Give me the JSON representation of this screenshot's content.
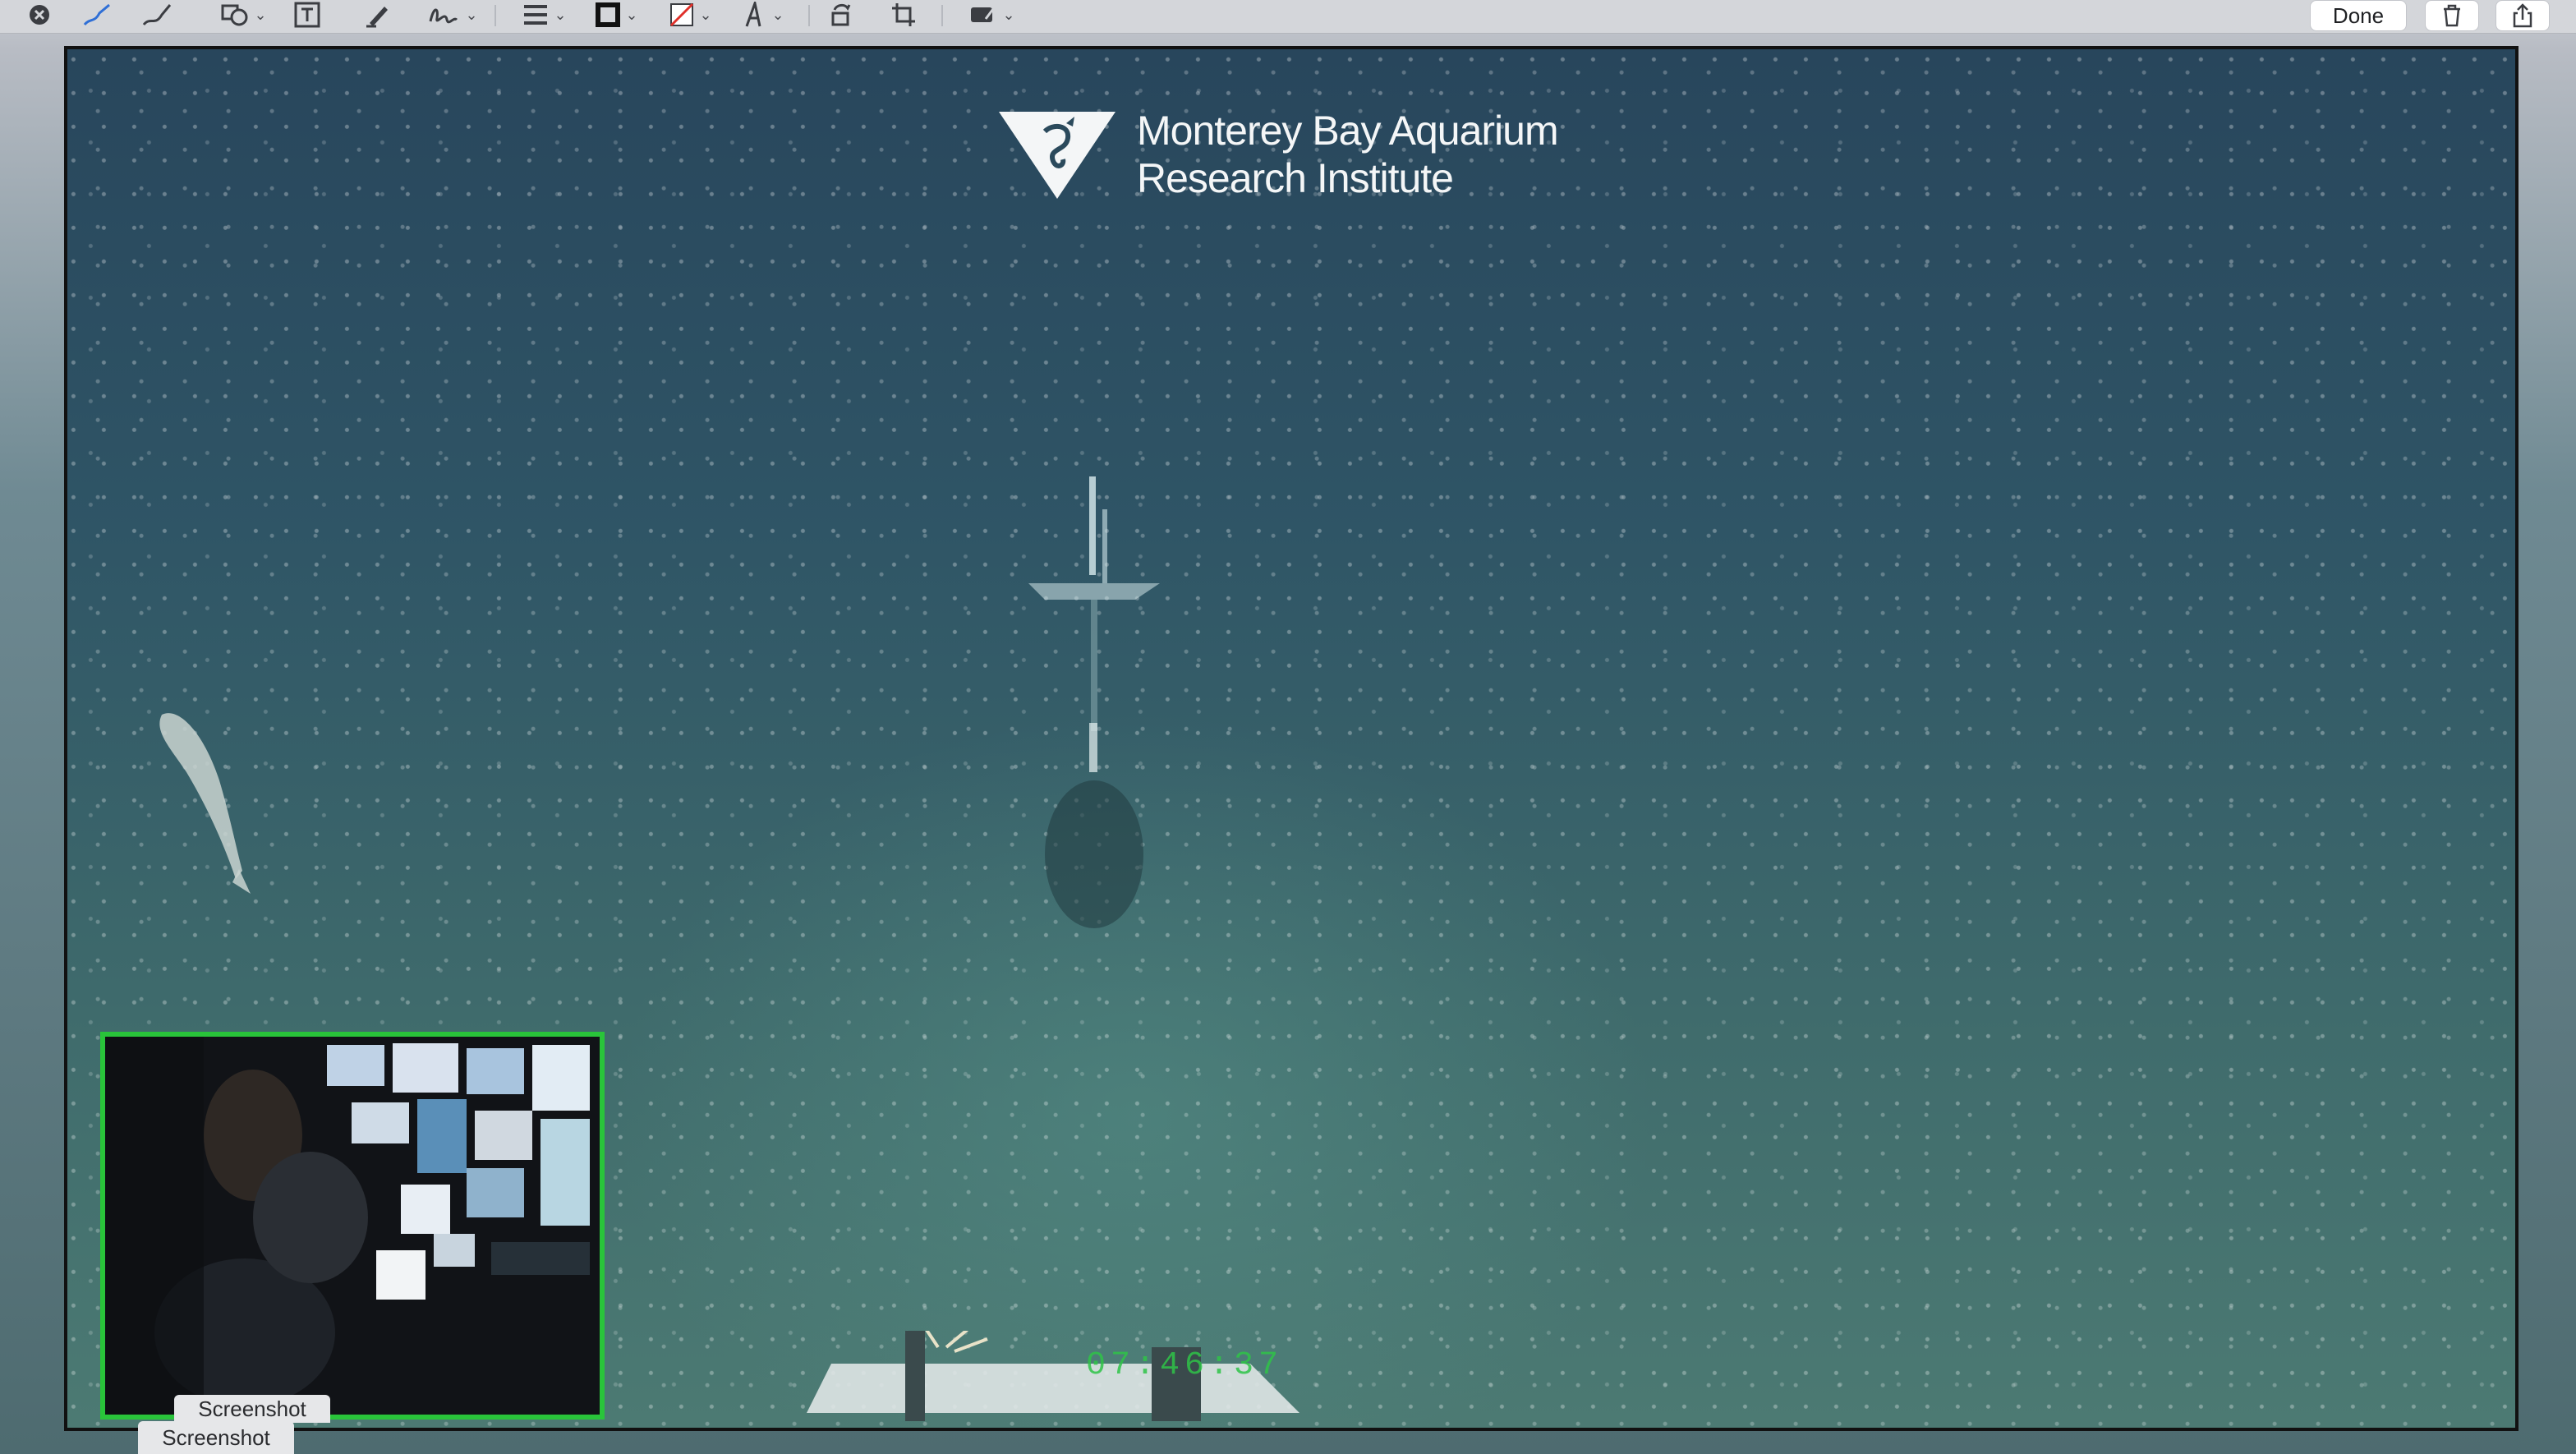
{
  "toolbar": {
    "done_label": "Done",
    "icons": [
      "close-icon",
      "sketch-icon",
      "draw-icon",
      "shapes-icon",
      "text-box-icon",
      "highlight-icon",
      "sign-icon",
      "shape-style-icon",
      "border-color-icon",
      "fill-color-icon",
      "text-style-icon",
      "rotate-icon",
      "crop-icon",
      "annotate-icon",
      "delete-icon",
      "share-icon"
    ]
  },
  "video": {
    "logo_line1": "Monterey Bay Aquarium",
    "logo_line2": "Research Institute",
    "timecode": "07:46:37"
  },
  "labels": {
    "screenshot_1": "Screenshot",
    "screenshot_2": "Screenshot"
  },
  "colors": {
    "pip_border": "#29c43a",
    "timecode": "#2fc448"
  }
}
